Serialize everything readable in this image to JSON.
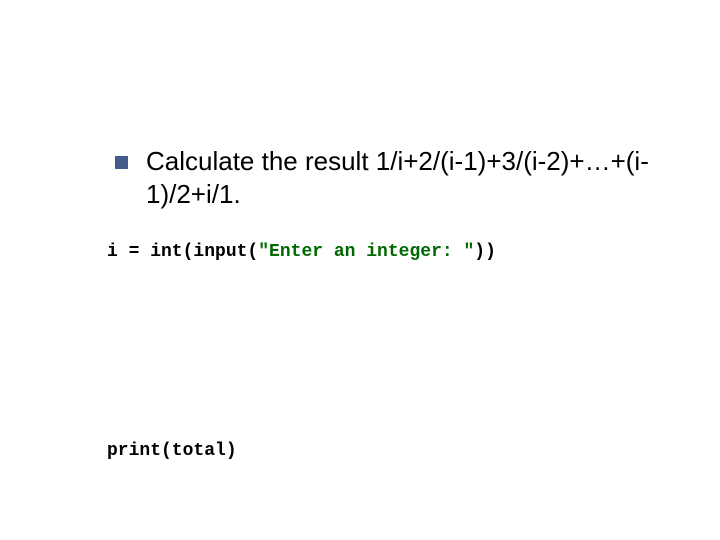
{
  "bullet": {
    "text": "Calculate the result 1/i+2/(i-1)+3/(i-2)+…+(i-1)/2+i/1."
  },
  "code": {
    "line1": {
      "prefix": "i = int(input(",
      "string": "\"Enter an integer: \"",
      "suffix": "))"
    },
    "line2": "print(total)"
  }
}
